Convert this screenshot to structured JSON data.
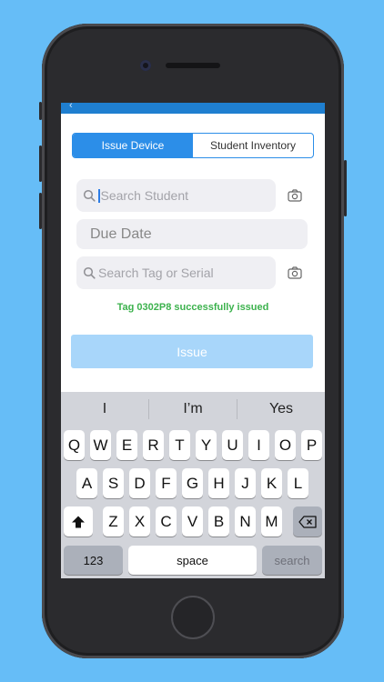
{
  "segments": {
    "issue_device": "Issue Device",
    "student_inventory": "Student Inventory"
  },
  "search_student": {
    "placeholder": "Search Student"
  },
  "due_date": {
    "placeholder": "Due Date"
  },
  "search_tag": {
    "placeholder": "Search Tag or Serial"
  },
  "status_message": "Tag 0302P8 successfully issued",
  "issue_button": "Issue",
  "suggestions": [
    "I",
    "I’m",
    "Yes"
  ],
  "keyboard": {
    "row1": [
      "Q",
      "W",
      "E",
      "R",
      "T",
      "Y",
      "U",
      "I",
      "O",
      "P"
    ],
    "row2": [
      "A",
      "S",
      "D",
      "F",
      "G",
      "H",
      "J",
      "K",
      "L"
    ],
    "row3": [
      "Z",
      "X",
      "C",
      "V",
      "B",
      "N",
      "M"
    ],
    "numbers": "123",
    "space": "space",
    "search": "search"
  },
  "colors": {
    "background": "#66bdf7",
    "accent": "#2c8ee8",
    "success": "#3cb24d",
    "issue_button": "#a8d6fa"
  }
}
